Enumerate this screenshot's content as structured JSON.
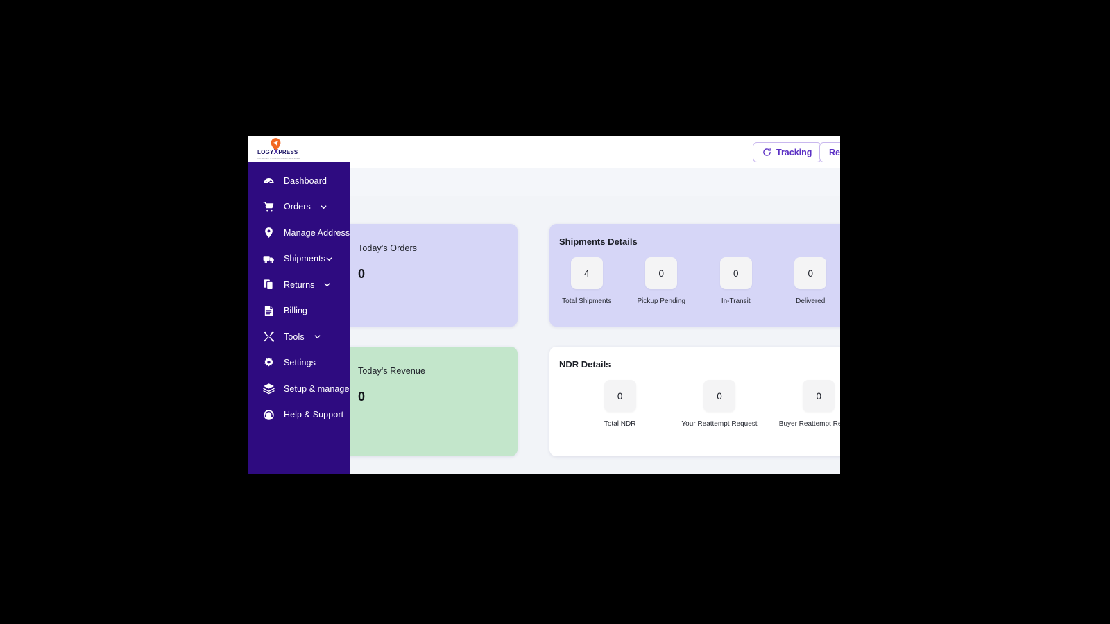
{
  "brand": {
    "logo_text_prefix": "LOGY",
    "logo_text_accent": "X",
    "logo_text_suffix": "PRESS",
    "logo_tagline": "YOUR ONE CLICK SHIPPING PARTNER",
    "sidebar_color": "#2e0b80",
    "accent_color": "#5b30c4",
    "logo_pin_color": "#f26722"
  },
  "header": {
    "tracking_label": "Tracking",
    "tracking_icon": "refresh-icon",
    "register_label": "Register"
  },
  "sidebar": {
    "items": [
      {
        "label": "Dashboard",
        "icon": "speedometer-icon",
        "expandable": false
      },
      {
        "label": "Orders",
        "icon": "cart-icon",
        "expandable": true
      },
      {
        "label": "Manage Address",
        "icon": "map-pin-icon",
        "expandable": false
      },
      {
        "label": "Shipments",
        "icon": "truck-icon",
        "expandable": true
      },
      {
        "label": "Returns",
        "icon": "copy-icon",
        "expandable": true
      },
      {
        "label": "Billing",
        "icon": "invoice-icon",
        "expandable": false
      },
      {
        "label": "Tools",
        "icon": "tools-icon",
        "expandable": true
      },
      {
        "label": "Settings",
        "icon": "gear-icon",
        "expandable": false
      },
      {
        "label": "Setup & manage",
        "icon": "layers-icon",
        "expandable": false
      },
      {
        "label": "Help & Support",
        "icon": "headset-icon",
        "expandable": false
      }
    ]
  },
  "main": {
    "todays_orders": {
      "label": "Today's Orders",
      "value": "0",
      "bg": "#d6d6f7"
    },
    "todays_revenue": {
      "label": "Today's Revenue",
      "value": "0",
      "bg": "#c3e6cb"
    },
    "shipments_details": {
      "title": "Shipments Details",
      "metrics": [
        {
          "value": "4",
          "name": "Total Shipments"
        },
        {
          "value": "0",
          "name": "Pickup Pending"
        },
        {
          "value": "0",
          "name": "In-Transit"
        },
        {
          "value": "0",
          "name": "Delivered"
        }
      ]
    },
    "ndr_details": {
      "title": "NDR Details",
      "metrics": [
        {
          "value": "0",
          "name": "Total NDR"
        },
        {
          "value": "0",
          "name": "Your Reattempt Request"
        },
        {
          "value": "0",
          "name": "Buyer Reattempt Request"
        }
      ]
    }
  }
}
